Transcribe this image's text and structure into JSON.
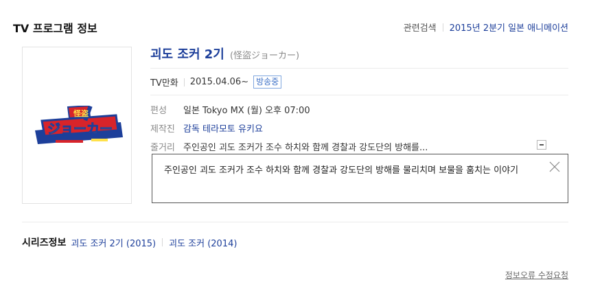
{
  "header": {
    "section_title": "TV 프로그램 정보",
    "related_label": "관련검색",
    "related_link": "2015년 2분기 일본 애니메이션"
  },
  "program": {
    "title": "괴도 조커 2기",
    "subtitle": "(怪盜ジョーカー)",
    "poster_logo_text": "怪盗ジョーカー",
    "category": "TV만화",
    "start_date": "2015.04.06~",
    "status_badge": "방송중"
  },
  "info": {
    "schedule_label": "편성",
    "schedule_value": "일본 Tokyo MX (월) 오후 07:00",
    "staff_label": "제작진",
    "staff_value": "감독 테라모토 유키요",
    "synopsis_label": "줄거리",
    "synopsis_short": "주인공인 괴도 조커가 조수 하치와 함께 경찰과 강도단의 방해를...",
    "synopsis_full": "주인공인 괴도 조커가 조수 하치와 함께 경찰과 강도단의 방해를 물리치며 보물을 훔치는 이야기"
  },
  "series": {
    "label": "시리즈정보",
    "items": [
      "괴도 조커 2기 (2015)",
      "괴도 조커 (2014)"
    ]
  },
  "footer": {
    "report_link": "정보오류 수정요청"
  },
  "colors": {
    "link": "#1c3e9a",
    "badge_border": "#7fa6df",
    "badge_text": "#3b6fc6",
    "logo_red": "#d8242a",
    "logo_blue": "#1d3f9a"
  },
  "icons": {
    "collapse": "minus-square-icon",
    "close": "close-x-icon"
  }
}
